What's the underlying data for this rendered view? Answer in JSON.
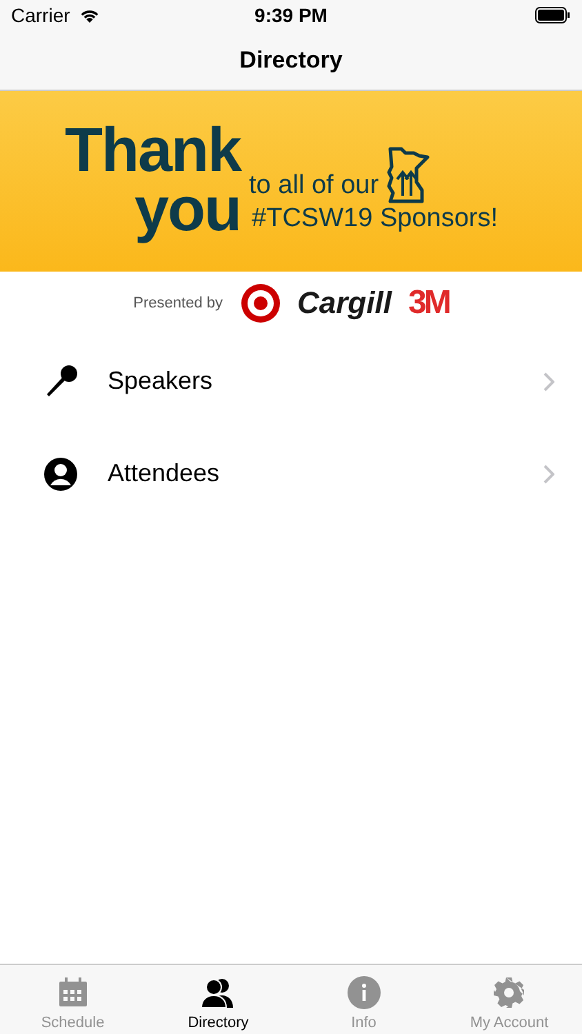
{
  "status_bar": {
    "carrier": "Carrier",
    "time": "9:39 PM"
  },
  "nav": {
    "title": "Directory"
  },
  "banner": {
    "headline_1": "Thank",
    "headline_2": "you",
    "line_1": "to all of our",
    "line_2": "#TCSW19 Sponsors!"
  },
  "sponsors": {
    "label": "Presented by",
    "logos": [
      {
        "kind": "target"
      },
      {
        "kind": "text",
        "text": "Cargill",
        "color": "#1a1a1a"
      },
      {
        "kind": "text",
        "text": "3M",
        "color": "#e02a2a"
      }
    ]
  },
  "list": [
    {
      "kind": "mic",
      "label": "Speakers"
    },
    {
      "kind": "person",
      "label": "Attendees"
    }
  ],
  "tabs": [
    {
      "kind": "calendar",
      "label": "Schedule",
      "selected": false
    },
    {
      "kind": "people",
      "label": "Directory",
      "selected": true
    },
    {
      "kind": "info",
      "label": "Info",
      "selected": false
    },
    {
      "kind": "gear",
      "label": "My Account",
      "selected": false
    }
  ]
}
